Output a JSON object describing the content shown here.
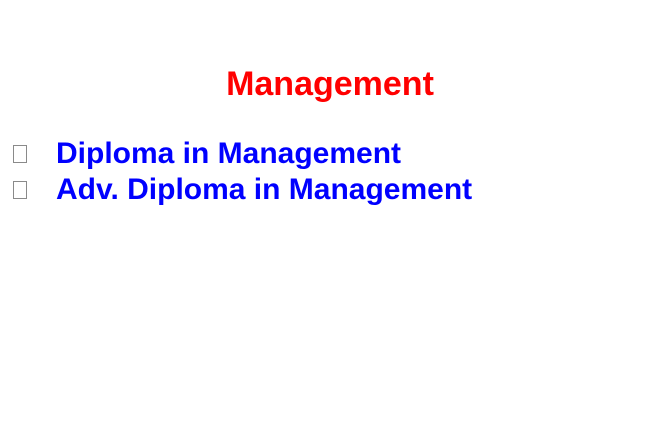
{
  "title": {
    "text": "Management",
    "color": "#ff0000"
  },
  "list": {
    "color": "#0000ff",
    "bullet_icon": "square-bullet-icon",
    "items": [
      {
        "label": "Diploma in Management"
      },
      {
        "label": "Adv. Diploma in Management"
      }
    ]
  }
}
